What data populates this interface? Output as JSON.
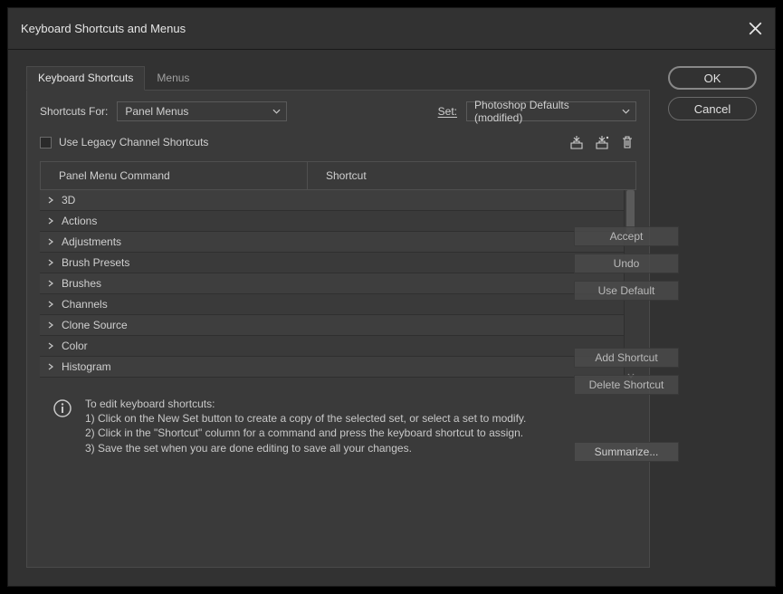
{
  "window": {
    "title": "Keyboard Shortcuts and Menus"
  },
  "tabs": {
    "shortcuts": "Keyboard Shortcuts",
    "menus": "Menus"
  },
  "shortcutsFor": {
    "label": "Shortcuts For:",
    "value": "Panel Menus"
  },
  "set": {
    "label": "Set:",
    "value": "Photoshop Defaults (modified)"
  },
  "legacy": {
    "label": "Use Legacy Channel Shortcuts"
  },
  "table": {
    "header": {
      "command": "Panel Menu Command",
      "shortcut": "Shortcut"
    },
    "rows": [
      {
        "label": "3D"
      },
      {
        "label": "Actions"
      },
      {
        "label": "Adjustments"
      },
      {
        "label": "Brush Presets"
      },
      {
        "label": "Brushes"
      },
      {
        "label": "Channels"
      },
      {
        "label": "Clone Source"
      },
      {
        "label": "Color"
      },
      {
        "label": "Histogram"
      }
    ]
  },
  "info": {
    "heading": "To edit keyboard shortcuts:",
    "l1": "1) Click on the New Set button to create a copy of the selected set, or select a set to modify.",
    "l2": "2) Click in the \"Shortcut\" column for a command and press the keyboard shortcut to assign.",
    "l3": "3) Save the set when you are done editing to save all your changes."
  },
  "sideButtons": {
    "accept": "Accept",
    "undo": "Undo",
    "useDefault": "Use Default",
    "addShortcut": "Add Shortcut",
    "deleteShortcut": "Delete Shortcut",
    "summarize": "Summarize..."
  },
  "footerButtons": {
    "ok": "OK",
    "cancel": "Cancel"
  }
}
